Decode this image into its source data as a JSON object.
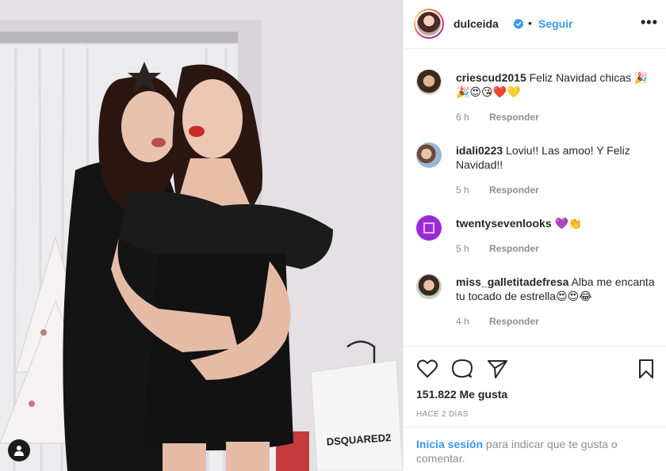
{
  "photo": {
    "alt_brand_text": "DSQUARED2"
  },
  "header": {
    "username": "dulceida",
    "separator": "•",
    "follow_label": "Seguir",
    "more_label": "•••"
  },
  "comments": [
    {
      "user": "criescud2015",
      "text": "Feliz Navidad chicas 🎉🎉😍😘❤️💛",
      "time": "6 h",
      "reply": "Responder"
    },
    {
      "user": "idali0223",
      "text": "Loviu!! Las amoo! Y Feliz Navidad!!",
      "time": "5 h",
      "reply": "Responder"
    },
    {
      "user": "twentysevenlooks",
      "text": "💜👏",
      "time": "5 h",
      "reply": "Responder"
    },
    {
      "user": "miss_galletitadefresa",
      "text": "Alba me encanta tu tocado de estrella😍😍😂",
      "time": "4 h",
      "reply": "Responder"
    }
  ],
  "footer": {
    "likes": "151.822 Me gusta",
    "posted_ago": "HACE 2 DÍAS",
    "login_link": "Inicia sesión",
    "login_rest": " para indicar que te gusta o comentar."
  },
  "colors": {
    "link_blue": "#3897f0",
    "text": "#262626",
    "muted": "#8e8e8e",
    "border": "#efefef"
  },
  "icons": [
    "heart-icon",
    "comment-icon",
    "share-icon",
    "bookmark-icon",
    "verified-badge-icon",
    "user-tag-icon",
    "more-options-icon"
  ]
}
